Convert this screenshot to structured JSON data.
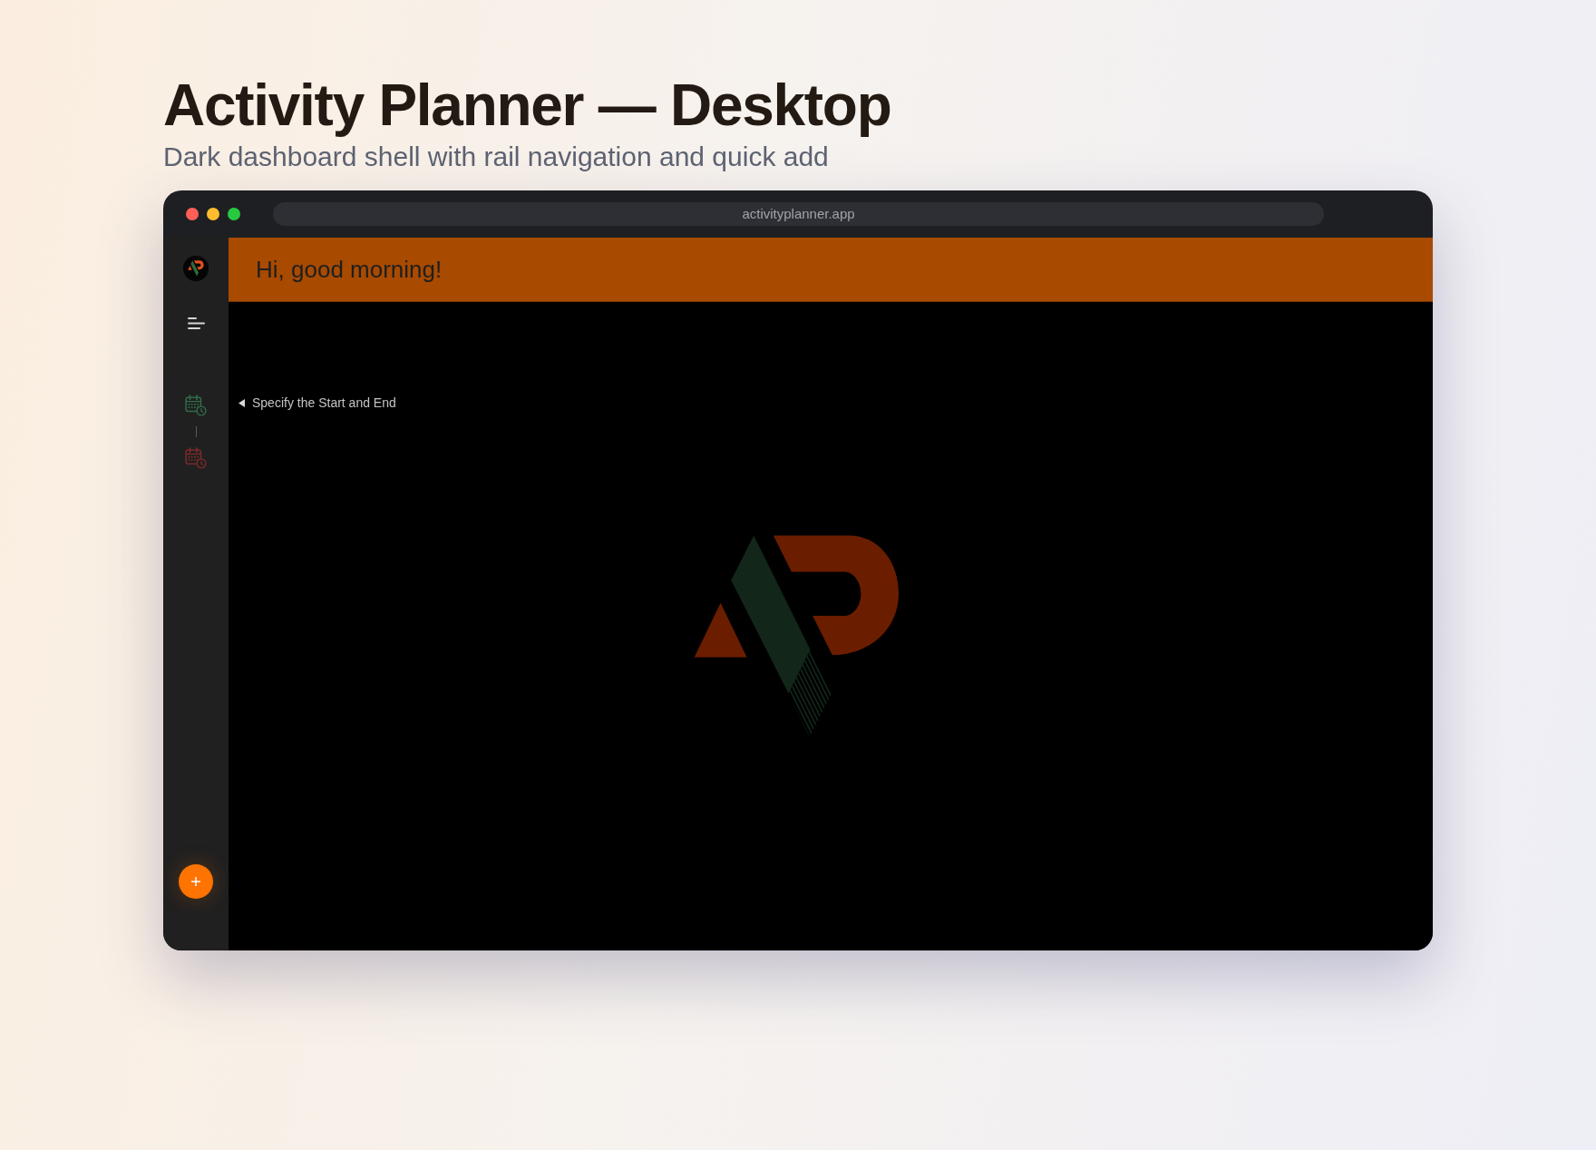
{
  "page": {
    "title": "Activity Planner — Desktop",
    "subtitle": "Dark dashboard shell with rail navigation and quick add"
  },
  "browser": {
    "address": "activityplanner.app"
  },
  "rail": {
    "date_range": [
      {
        "color": "#2f6b4a"
      },
      {
        "color": "#7b2a2a"
      }
    ]
  },
  "header": {
    "greeting": "Hi, good morning!"
  },
  "main": {
    "hint": "Specify the Start and End"
  }
}
